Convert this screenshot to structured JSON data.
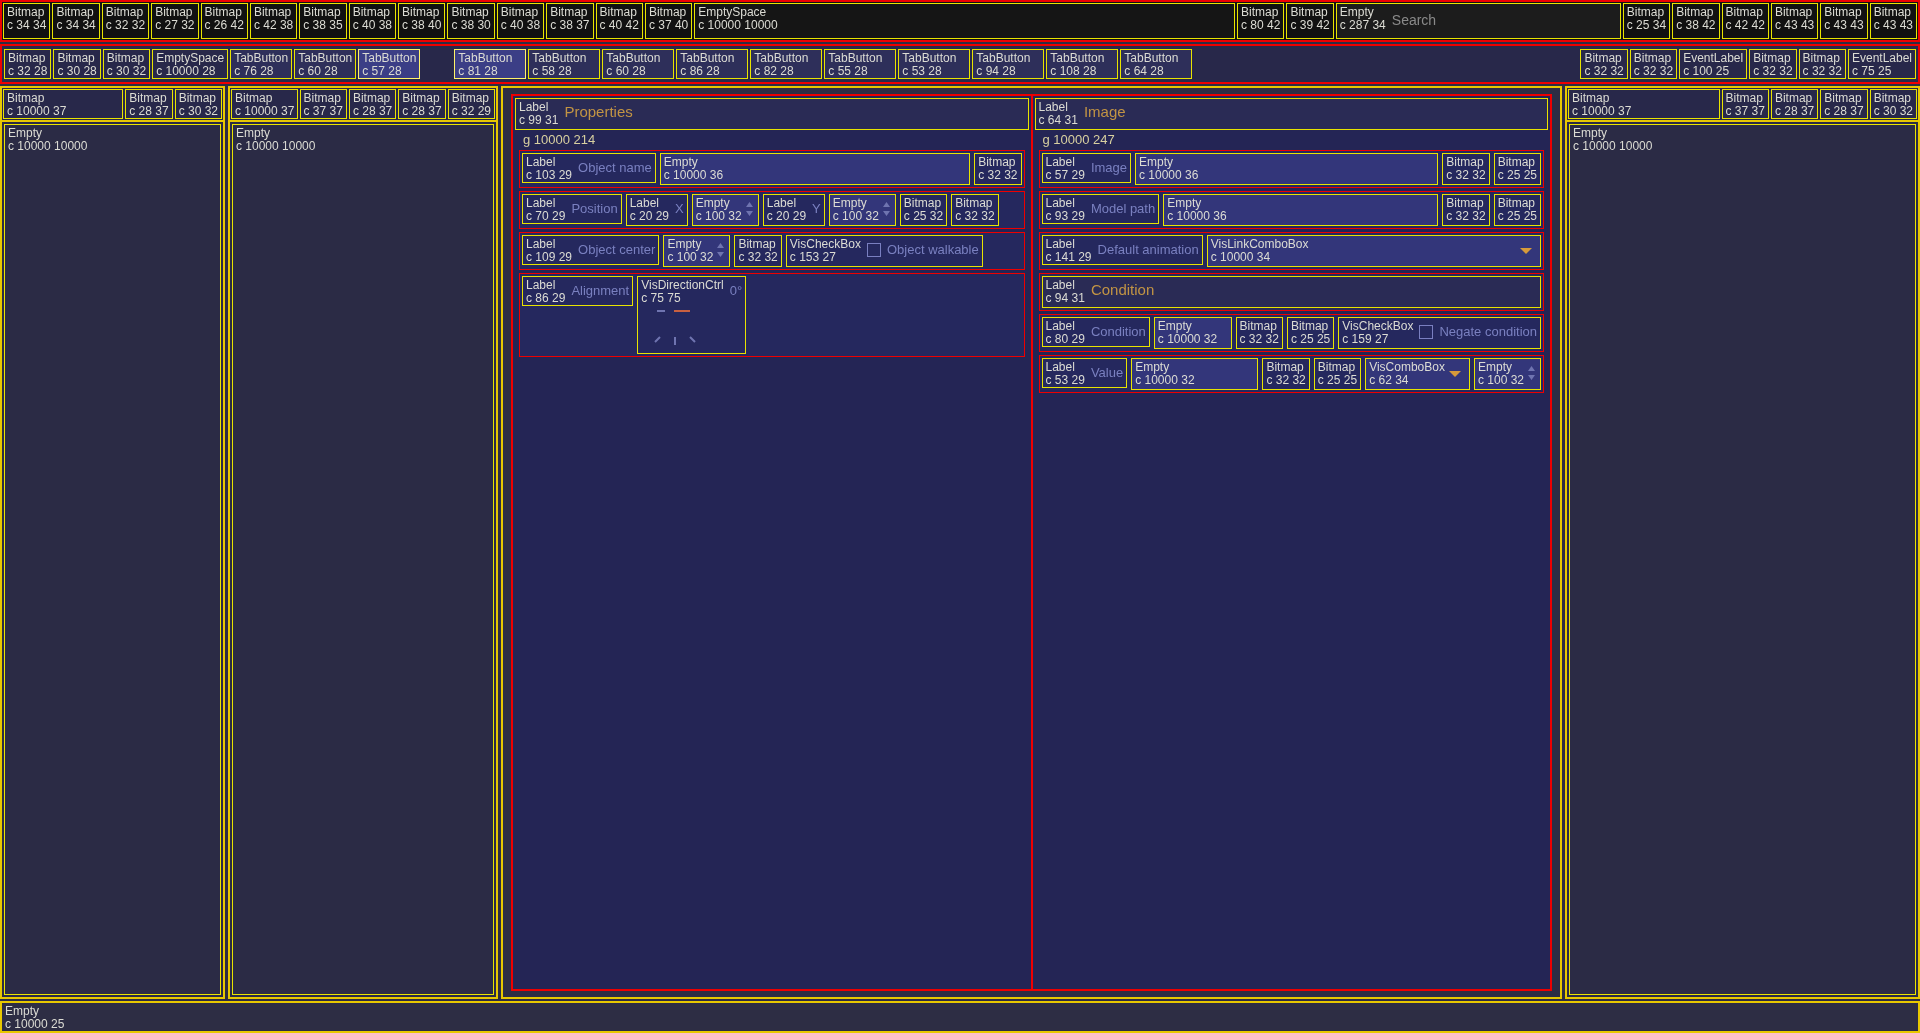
{
  "toolbar": {
    "left_items": [
      {
        "type": "Bitmap",
        "size": "c 34 34"
      },
      {
        "type": "Bitmap",
        "size": "c 34 34"
      },
      {
        "type": "Bitmap",
        "size": "c 32 32"
      },
      {
        "type": "Bitmap",
        "size": "c 27 32"
      },
      {
        "type": "Bitmap",
        "size": "c 26 42"
      },
      {
        "type": "Bitmap",
        "size": "c 42 38"
      },
      {
        "type": "Bitmap",
        "size": "c 38 35"
      },
      {
        "type": "Bitmap",
        "size": "c 40 38"
      },
      {
        "type": "Bitmap",
        "size": "c 38 40"
      },
      {
        "type": "Bitmap",
        "size": "c 38 30"
      },
      {
        "type": "Bitmap",
        "size": "c 40 38"
      },
      {
        "type": "Bitmap",
        "size": "c 38 37"
      },
      {
        "type": "Bitmap",
        "size": "c 40 42"
      },
      {
        "type": "Bitmap",
        "size": "c 37 40"
      }
    ],
    "spacer": {
      "type": "EmptySpace",
      "size": "c 10000 10000"
    },
    "mid_items": [
      {
        "type": "Bitmap",
        "size": "c 80 42"
      },
      {
        "type": "Bitmap",
        "size": "c 39 42"
      }
    ],
    "search": {
      "type": "Empty",
      "size": "c 287 34",
      "placeholder": "Search"
    },
    "right_items": [
      {
        "type": "Bitmap",
        "size": "c 25 34"
      },
      {
        "type": "Bitmap",
        "size": "c 38 42"
      },
      {
        "type": "Bitmap",
        "size": "c 42 42"
      },
      {
        "type": "Bitmap",
        "size": "c 43 43"
      },
      {
        "type": "Bitmap",
        "size": "c 43 43"
      },
      {
        "type": "Bitmap",
        "size": "c 43 43"
      }
    ]
  },
  "tabbar": {
    "left_items": [
      {
        "type": "Bitmap",
        "size": "c 32 28"
      },
      {
        "type": "Bitmap",
        "size": "c 30 28"
      },
      {
        "type": "Bitmap",
        "size": "c 30 32"
      },
      {
        "type": "EmptySpace",
        "size": "c 10000 28"
      }
    ],
    "panel_tabs": [
      {
        "type": "TabButton",
        "size": "c 76 28",
        "selected": false
      },
      {
        "type": "TabButton",
        "size": "c 60 28",
        "selected": false
      },
      {
        "type": "TabButton",
        "size": "c 57 28",
        "selected": true
      }
    ],
    "main_tabs": [
      {
        "type": "TabButton",
        "size": "c 81 28",
        "selected": true
      },
      {
        "type": "TabButton",
        "size": "c 58 28",
        "selected": false
      },
      {
        "type": "TabButton",
        "size": "c 60 28",
        "selected": false
      },
      {
        "type": "TabButton",
        "size": "c 86 28",
        "selected": false
      },
      {
        "type": "TabButton",
        "size": "c 82 28",
        "selected": false
      },
      {
        "type": "TabButton",
        "size": "c 55 28",
        "selected": false
      },
      {
        "type": "TabButton",
        "size": "c 53 28",
        "selected": false
      },
      {
        "type": "TabButton",
        "size": "c 94 28",
        "selected": false
      },
      {
        "type": "TabButton",
        "size": "c 108 28",
        "selected": false
      },
      {
        "type": "TabButton",
        "size": "c 64 28",
        "selected": false
      }
    ],
    "right_items": [
      {
        "type": "Bitmap",
        "size": "c 32 32"
      },
      {
        "type": "Bitmap",
        "size": "c 32 32"
      },
      {
        "type": "EventLabel",
        "size": "c 100 25"
      },
      {
        "type": "Bitmap",
        "size": "c 32 32"
      },
      {
        "type": "Bitmap",
        "size": "c 32 32"
      },
      {
        "type": "EventLabel",
        "size": "c 75 25"
      }
    ]
  },
  "panels": [
    {
      "header": [
        {
          "type": "Bitmap",
          "size": "c 10000 37"
        },
        {
          "type": "Bitmap",
          "size": "c 28 37"
        },
        {
          "type": "Bitmap",
          "size": "c 30 32"
        }
      ],
      "body": {
        "type": "Empty",
        "size": "c 10000 10000"
      }
    },
    {
      "header": [
        {
          "type": "Bitmap",
          "size": "c 10000 37"
        },
        {
          "type": "Bitmap",
          "size": "c 37 37"
        },
        {
          "type": "Bitmap",
          "size": "c 28 37"
        },
        {
          "type": "Bitmap",
          "size": "c 28 37"
        },
        {
          "type": "Bitmap",
          "size": "c 32 29"
        }
      ],
      "body": {
        "type": "Empty",
        "size": "c 10000 10000"
      }
    }
  ],
  "properties": [
    {
      "header": {
        "type": "Label",
        "size": "c 99 31",
        "caption": "Properties"
      },
      "group": "g 10000 214",
      "rows": [
        {
          "label": {
            "type": "Label",
            "size": "c 103 29",
            "caption": "Object name"
          },
          "controls": [
            {
              "kind": "field",
              "type": "Empty",
              "size": "c 10000 36"
            },
            {
              "kind": "bitmap",
              "type": "Bitmap",
              "size": "c 32 32"
            }
          ]
        },
        {
          "label": {
            "type": "Label",
            "size": "c 70 29",
            "caption": "Position"
          },
          "controls": [
            {
              "kind": "label",
              "type": "Label",
              "size": "c 20 29",
              "caption": "X"
            },
            {
              "kind": "spin",
              "type": "Empty",
              "size": "c 100 32"
            },
            {
              "kind": "label",
              "type": "Label",
              "size": "c 20 29",
              "caption": "Y"
            },
            {
              "kind": "spin",
              "type": "Empty",
              "size": "c 100 32"
            },
            {
              "kind": "bitmap",
              "type": "Bitmap",
              "size": "c 25 32"
            },
            {
              "kind": "bitmap",
              "type": "Bitmap",
              "size": "c 32 32"
            }
          ]
        },
        {
          "label": {
            "type": "Label",
            "size": "c 109 29",
            "caption": "Object center"
          },
          "controls": [
            {
              "kind": "spin",
              "type": "Empty",
              "size": "c 100 32"
            },
            {
              "kind": "bitmap",
              "type": "Bitmap",
              "size": "c 32 32"
            },
            {
              "kind": "check",
              "type": "VisCheckBox",
              "size": "c 153 27",
              "caption": "Object walkable",
              "checked": false
            }
          ]
        },
        {
          "label": {
            "type": "Label",
            "size": "c 86 29",
            "caption": "Alignment"
          },
          "controls": [
            {
              "kind": "dial",
              "type": "VisDirectionCtrl",
              "size": "c 75 75",
              "caption": "0°"
            }
          ]
        }
      ]
    },
    {
      "header": {
        "type": "Label",
        "size": "c 64 31",
        "caption": "Image"
      },
      "group": "g 10000 247",
      "rows": [
        {
          "label": {
            "type": "Label",
            "size": "c 57 29",
            "caption": "Image"
          },
          "controls": [
            {
              "kind": "field",
              "type": "Empty",
              "size": "c 10000 36"
            },
            {
              "kind": "bitmap",
              "type": "Bitmap",
              "size": "c 32 32"
            },
            {
              "kind": "bitmap",
              "type": "Bitmap",
              "size": "c 25 25"
            }
          ]
        },
        {
          "label": {
            "type": "Label",
            "size": "c 93 29",
            "caption": "Model path"
          },
          "controls": [
            {
              "kind": "field",
              "type": "Empty",
              "size": "c 10000 36"
            },
            {
              "kind": "bitmap",
              "type": "Bitmap",
              "size": "c 32 32"
            },
            {
              "kind": "bitmap",
              "type": "Bitmap",
              "size": "c 25 25"
            }
          ]
        },
        {
          "label": {
            "type": "Label",
            "size": "c 141 29",
            "caption": "Default animation"
          },
          "controls": [
            {
              "kind": "combo",
              "type": "VisLinkComboBox",
              "size": "c 10000 34"
            }
          ]
        },
        {
          "heading": {
            "type": "Label",
            "size": "c 94 31",
            "caption": "Condition"
          }
        },
        {
          "label": {
            "type": "Label",
            "size": "c 80 29",
            "caption": "Condition"
          },
          "controls": [
            {
              "kind": "field",
              "type": "Empty",
              "size": "c 10000 32"
            },
            {
              "kind": "bitmap",
              "type": "Bitmap",
              "size": "c 32 32"
            },
            {
              "kind": "bitmap",
              "type": "Bitmap",
              "size": "c 25 25"
            },
            {
              "kind": "check",
              "type": "VisCheckBox",
              "size": "c 159 27",
              "caption": "Negate condition",
              "checked": false
            }
          ]
        },
        {
          "label": {
            "type": "Label",
            "size": "c 53 29",
            "caption": "Value"
          },
          "controls": [
            {
              "kind": "field",
              "type": "Empty",
              "size": "c 10000 32"
            },
            {
              "kind": "bitmap",
              "type": "Bitmap",
              "size": "c 32 32"
            },
            {
              "kind": "bitmap",
              "type": "Bitmap",
              "size": "c 25 25"
            },
            {
              "kind": "combo",
              "type": "VisComboBox",
              "size": "c 62 34"
            },
            {
              "kind": "spin",
              "type": "Empty",
              "size": "c 100 32"
            }
          ]
        }
      ]
    }
  ],
  "right_panel": {
    "header": [
      {
        "type": "Bitmap",
        "size": "c 10000 37"
      },
      {
        "type": "Bitmap",
        "size": "c 37 37"
      },
      {
        "type": "Bitmap",
        "size": "c 28 37"
      },
      {
        "type": "Bitmap",
        "size": "c 28 37"
      },
      {
        "type": "Bitmap",
        "size": "c 30 32"
      }
    ],
    "body": {
      "type": "Empty",
      "size": "c 10000 10000"
    }
  },
  "status_bar": {
    "type": "Empty",
    "size": "c 10000 25"
  }
}
